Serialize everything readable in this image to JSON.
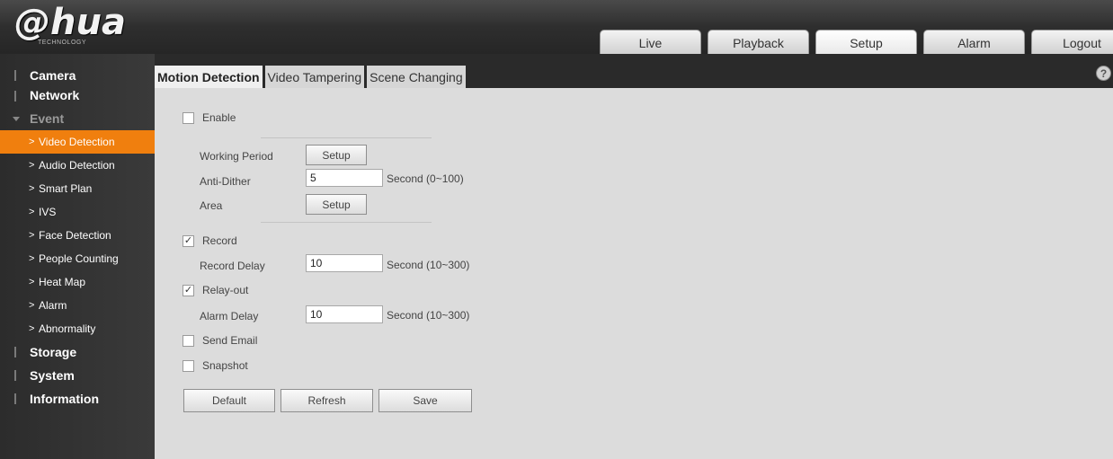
{
  "brand": {
    "logo": "@hua",
    "tagline": "TECHNOLOGY"
  },
  "topnav": [
    "Live",
    "Playback",
    "Setup",
    "Alarm",
    "Logout"
  ],
  "sidebar": {
    "camera": "Camera",
    "network": "Network",
    "event": "Event",
    "sub": [
      "Video Detection",
      "Audio Detection",
      "Smart Plan",
      "IVS",
      "Face Detection",
      "People Counting",
      "Heat Map",
      "Alarm",
      "Abnormality"
    ],
    "storage": "Storage",
    "system": "System",
    "information": "Information"
  },
  "tabs": [
    "Motion Detection",
    "Video Tampering",
    "Scene Changing"
  ],
  "help_icon": "?",
  "form": {
    "enable": "Enable",
    "working_period": "Working Period",
    "working_period_btn": "Setup",
    "anti_dither": "Anti-Dither",
    "anti_dither_value": "5",
    "anti_dither_unit": "Second (0~100)",
    "area": "Area",
    "area_btn": "Setup",
    "record": "Record",
    "record_delay": "Record Delay",
    "record_delay_value": "10",
    "record_delay_unit": "Second (10~300)",
    "relay_out": "Relay-out",
    "alarm_delay": "Alarm Delay",
    "alarm_delay_value": "10",
    "alarm_delay_unit": "Second (10~300)",
    "send_email": "Send Email",
    "snapshot": "Snapshot",
    "checkmark": "✓"
  },
  "buttons": {
    "default": "Default",
    "refresh": "Refresh",
    "save": "Save"
  },
  "colors": {
    "accent": "#f07f0e",
    "panel": "#dcdcdc",
    "sidebar": "#333333"
  }
}
